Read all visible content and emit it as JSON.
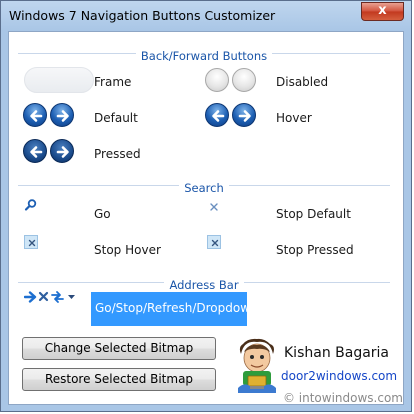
{
  "window": {
    "title": "Windows 7 Navigation Buttons Customizer",
    "close_glyph": "x"
  },
  "sections": {
    "back_forward": "Back/Forward Buttons",
    "search": "Search",
    "address_bar": "Address Bar"
  },
  "back_forward": {
    "frame": "Frame",
    "disabled": "Disabled",
    "default": "Default",
    "hover": "Hover",
    "pressed": "Pressed"
  },
  "search": {
    "go": "Go",
    "stop_default": "Stop Default",
    "stop_hover": "Stop Hover",
    "stop_pressed": "Stop Pressed"
  },
  "address_bar": {
    "selected_item": "Go/Stop/Refresh/Dropdown"
  },
  "actions": {
    "change_bitmap": "Change Selected Bitmap",
    "restore_bitmap": "Restore Selected Bitmap"
  },
  "credits": {
    "author": "Kishan Bagaria",
    "website": "door2windows.com"
  },
  "watermark": "intowindows.com",
  "colors": {
    "accent": "#3399ff",
    "section_heading": "#1a55a8",
    "link": "#1546c7"
  }
}
